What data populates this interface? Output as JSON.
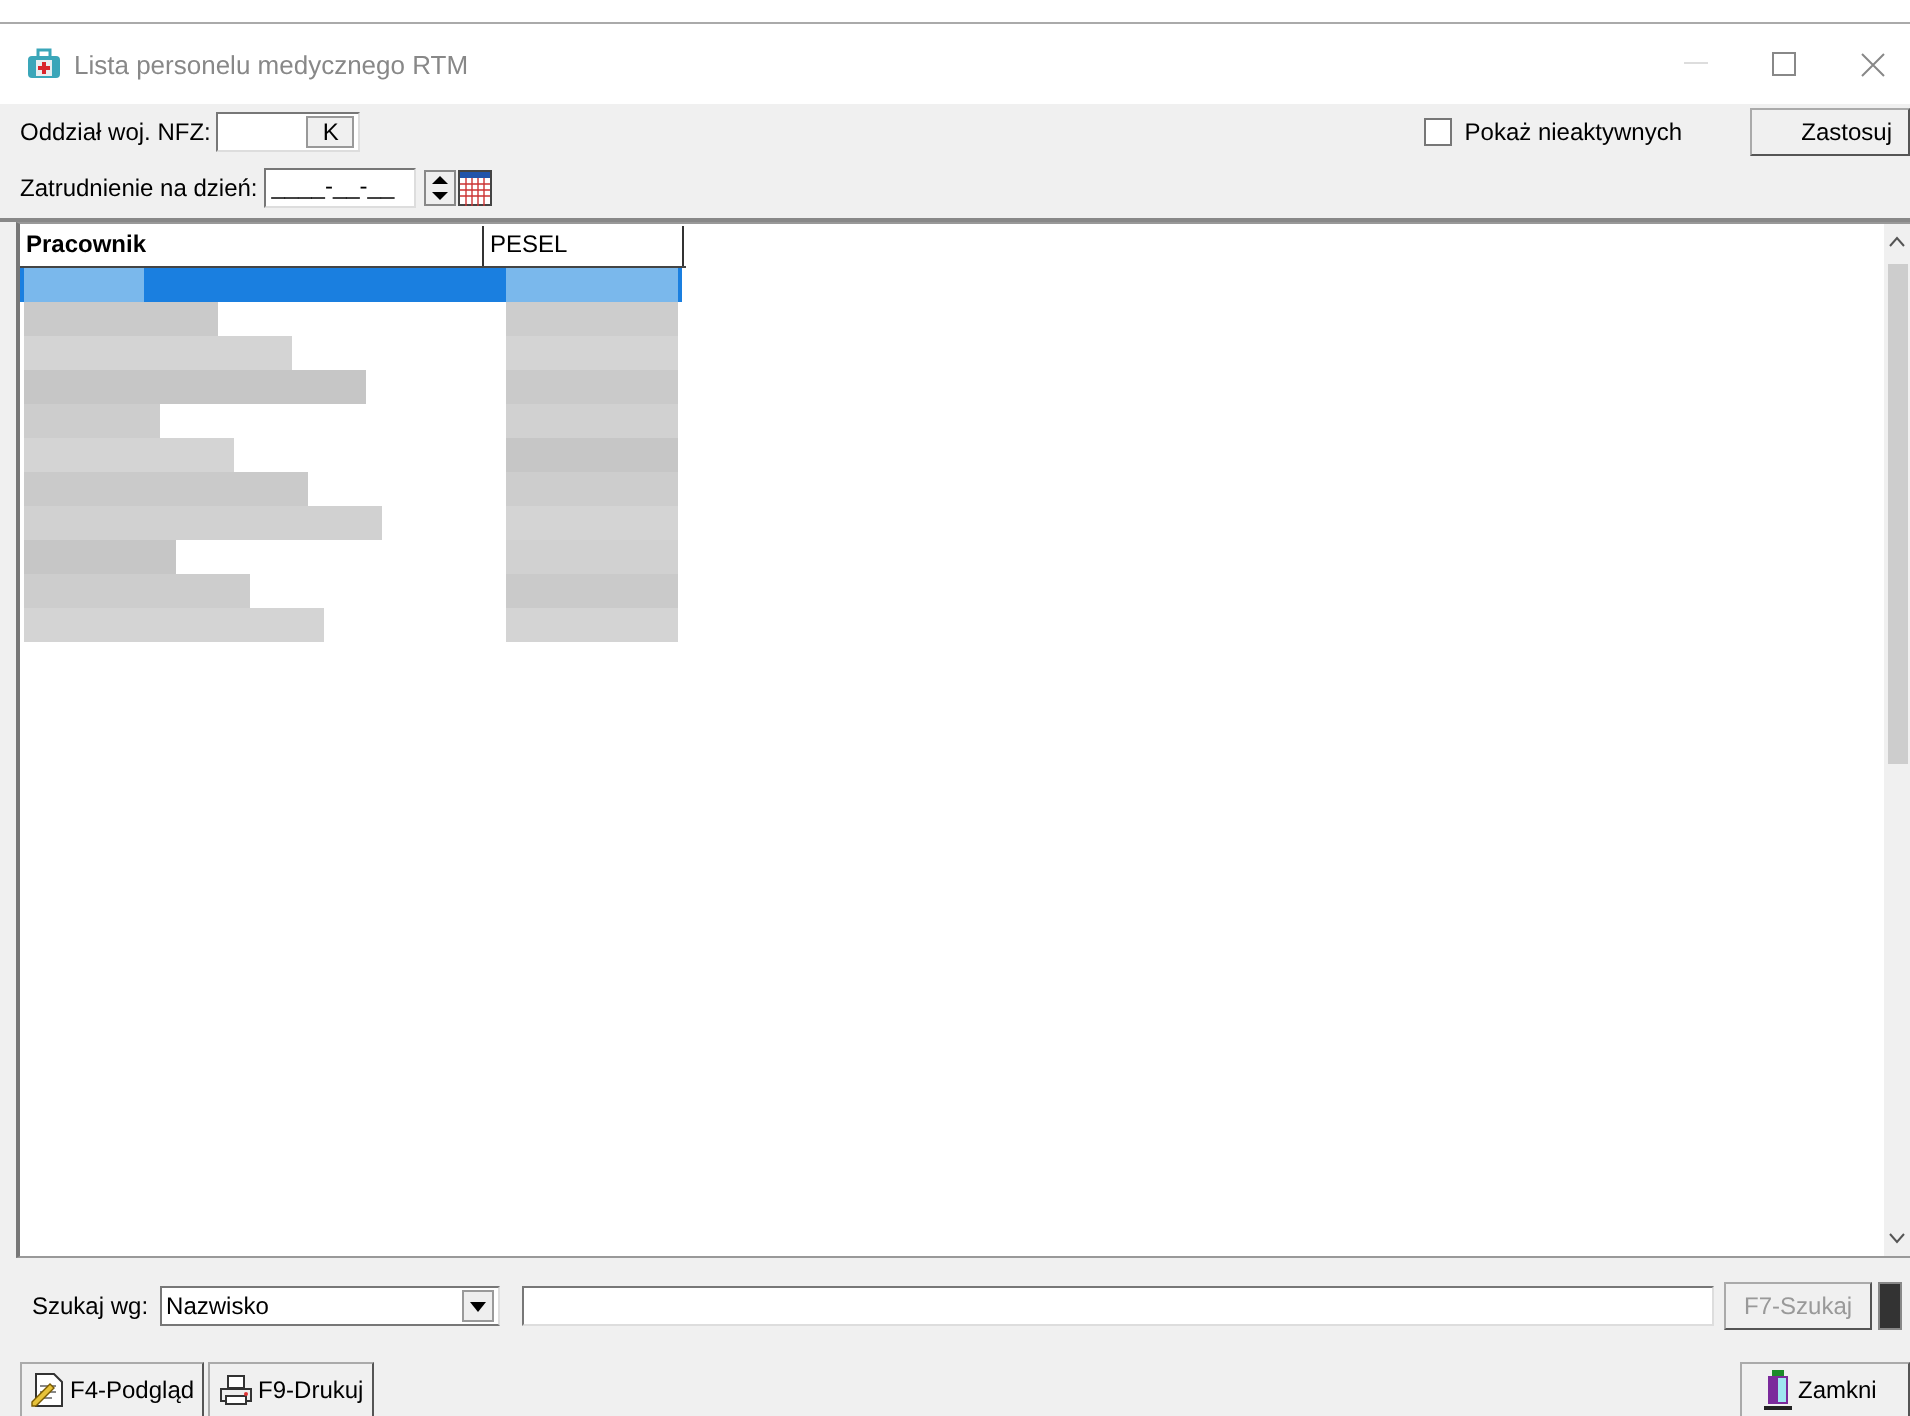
{
  "window": {
    "title": "Lista personelu medycznego RTM"
  },
  "filters": {
    "nfz_label": "Oddział woj. NFZ:",
    "nfz_button": "K",
    "date_label": "Zatrudnienie na dzień:",
    "date_value": "____-__-__",
    "show_inactive": {
      "label": "Pokaż nieaktywnych",
      "checked": false
    },
    "apply_button": "Zastosuj"
  },
  "table": {
    "columns": [
      "Pracownik",
      "PESEL"
    ],
    "rows": [
      {
        "selected": true
      },
      {
        "selected": false
      },
      {
        "selected": false
      },
      {
        "selected": false
      },
      {
        "selected": false
      },
      {
        "selected": false
      },
      {
        "selected": false
      },
      {
        "selected": false
      },
      {
        "selected": false
      },
      {
        "selected": false
      },
      {
        "selected": false
      }
    ]
  },
  "search": {
    "label": "Szukaj wg:",
    "field": "Nazwisko",
    "button": {
      "label": "F7-Szukaj",
      "disabled": true
    }
  },
  "buttons": [
    {
      "label": "F4-Podgląd",
      "kind": "preview"
    },
    {
      "label": "F9-Drukuj",
      "kind": "print"
    },
    {
      "label": "Zamkni",
      "kind": "close"
    }
  ]
}
